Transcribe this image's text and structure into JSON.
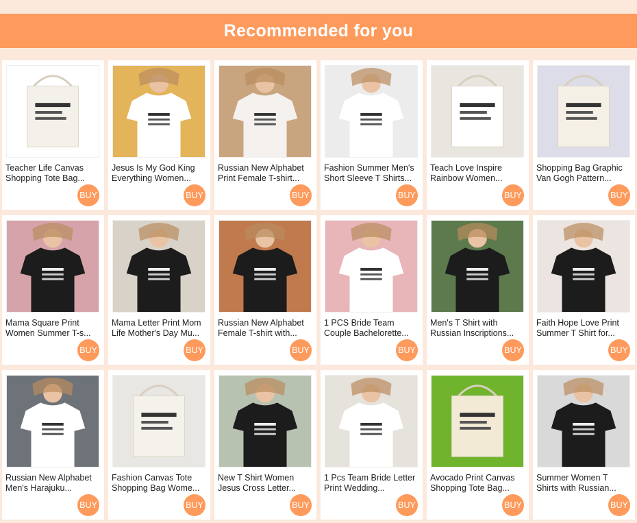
{
  "header": {
    "title": "Recommended for you"
  },
  "buy_label": "BUY",
  "colors": {
    "accent": "#fd9a5c",
    "background": "#fce9dc"
  },
  "products": [
    {
      "title": "Teacher Life Canvas Shopping Tote Bag...",
      "image": "tote-bags-teacher-quotes",
      "bg": "#ffffff",
      "shirt": "#f4f1ea"
    },
    {
      "title": "Jesus Is My God King Everything Women...",
      "image": "white-tshirt-jesus-text",
      "bg": "#e4b45a",
      "shirt": "#ffffff"
    },
    {
      "title": "Russian New Alphabet Print Female T-shirt...",
      "image": "white-tshirt-alphabet",
      "bg": "#c9a57f",
      "shirt": "#f4f1ee"
    },
    {
      "title": "Fashion Summer Men's Short Sleeve T Shirts...",
      "image": "white-tshirt-doner-kebab",
      "bg": "#ececec",
      "shirt": "#ffffff"
    },
    {
      "title": "Teach Love Inspire Rainbow Women...",
      "image": "tote-bags-rainbow",
      "bg": "#e9e6e0",
      "shirt": "#ffffff"
    },
    {
      "title": "Shopping Bag Graphic Van Gogh Pattern...",
      "image": "tote-bag-van-gogh",
      "bg": "#dcdde8",
      "shirt": "#f5f0e6"
    },
    {
      "title": "Mama Square Print Women Summer T-s...",
      "image": "black-tshirt-mama",
      "bg": "#d6a3aa",
      "shirt": "#1c1c1c"
    },
    {
      "title": "Mama Letter Print Mom Life Mother's Day Mu...",
      "image": "black-tshirt-mama-script",
      "bg": "#d8d2c8",
      "shirt": "#1c1c1c"
    },
    {
      "title": "Russian New Alphabet Female T-shirt with...",
      "image": "black-tshirt-alphabet",
      "bg": "#c07a4e",
      "shirt": "#1c1c1c"
    },
    {
      "title": "1 PCS Bride Team Couple Bachelorette...",
      "image": "bride-team-group",
      "bg": "#e8b5b8",
      "shirt": "#ffffff"
    },
    {
      "title": "Men's T Shirt with Russian Inscriptions...",
      "image": "black-tshirt-beard",
      "bg": "#5c7a4c",
      "shirt": "#1c1c1c"
    },
    {
      "title": "Faith Hope Love Print Summer T Shirt for...",
      "image": "black-tshirt-faith",
      "bg": "#ece4e0",
      "shirt": "#1c1c1c"
    },
    {
      "title": "Russian New Alphabet Men's Harajuku...",
      "image": "white-tshirt-alphabet-men",
      "bg": "#6e737a",
      "shirt": "#ffffff"
    },
    {
      "title": "Fashion Canvas Tote Shopping Bag Wome...",
      "image": "tote-bags-quotes",
      "bg": "#e9e7e3",
      "shirt": "#f5f2ec"
    },
    {
      "title": "New T Shirt Women Jesus Cross Letter...",
      "image": "black-tshirt-jesus-cross",
      "bg": "#b8c2b0",
      "shirt": "#1c1c1c"
    },
    {
      "title": "1 Pcs Team Bride Letter Print Wedding...",
      "image": "team-bride-pink-skirts",
      "bg": "#e6e2dc",
      "shirt": "#ffffff"
    },
    {
      "title": "Avocado Print Canvas Shopping Tote Bag...",
      "image": "avocado-tote-bags",
      "bg": "#6fb42c",
      "shirt": "#f3ead6"
    },
    {
      "title": "Summer Women T Shirts with Russian...",
      "image": "black-tshirt-russian-text",
      "bg": "#d9d9d9",
      "shirt": "#1c1c1c"
    }
  ]
}
